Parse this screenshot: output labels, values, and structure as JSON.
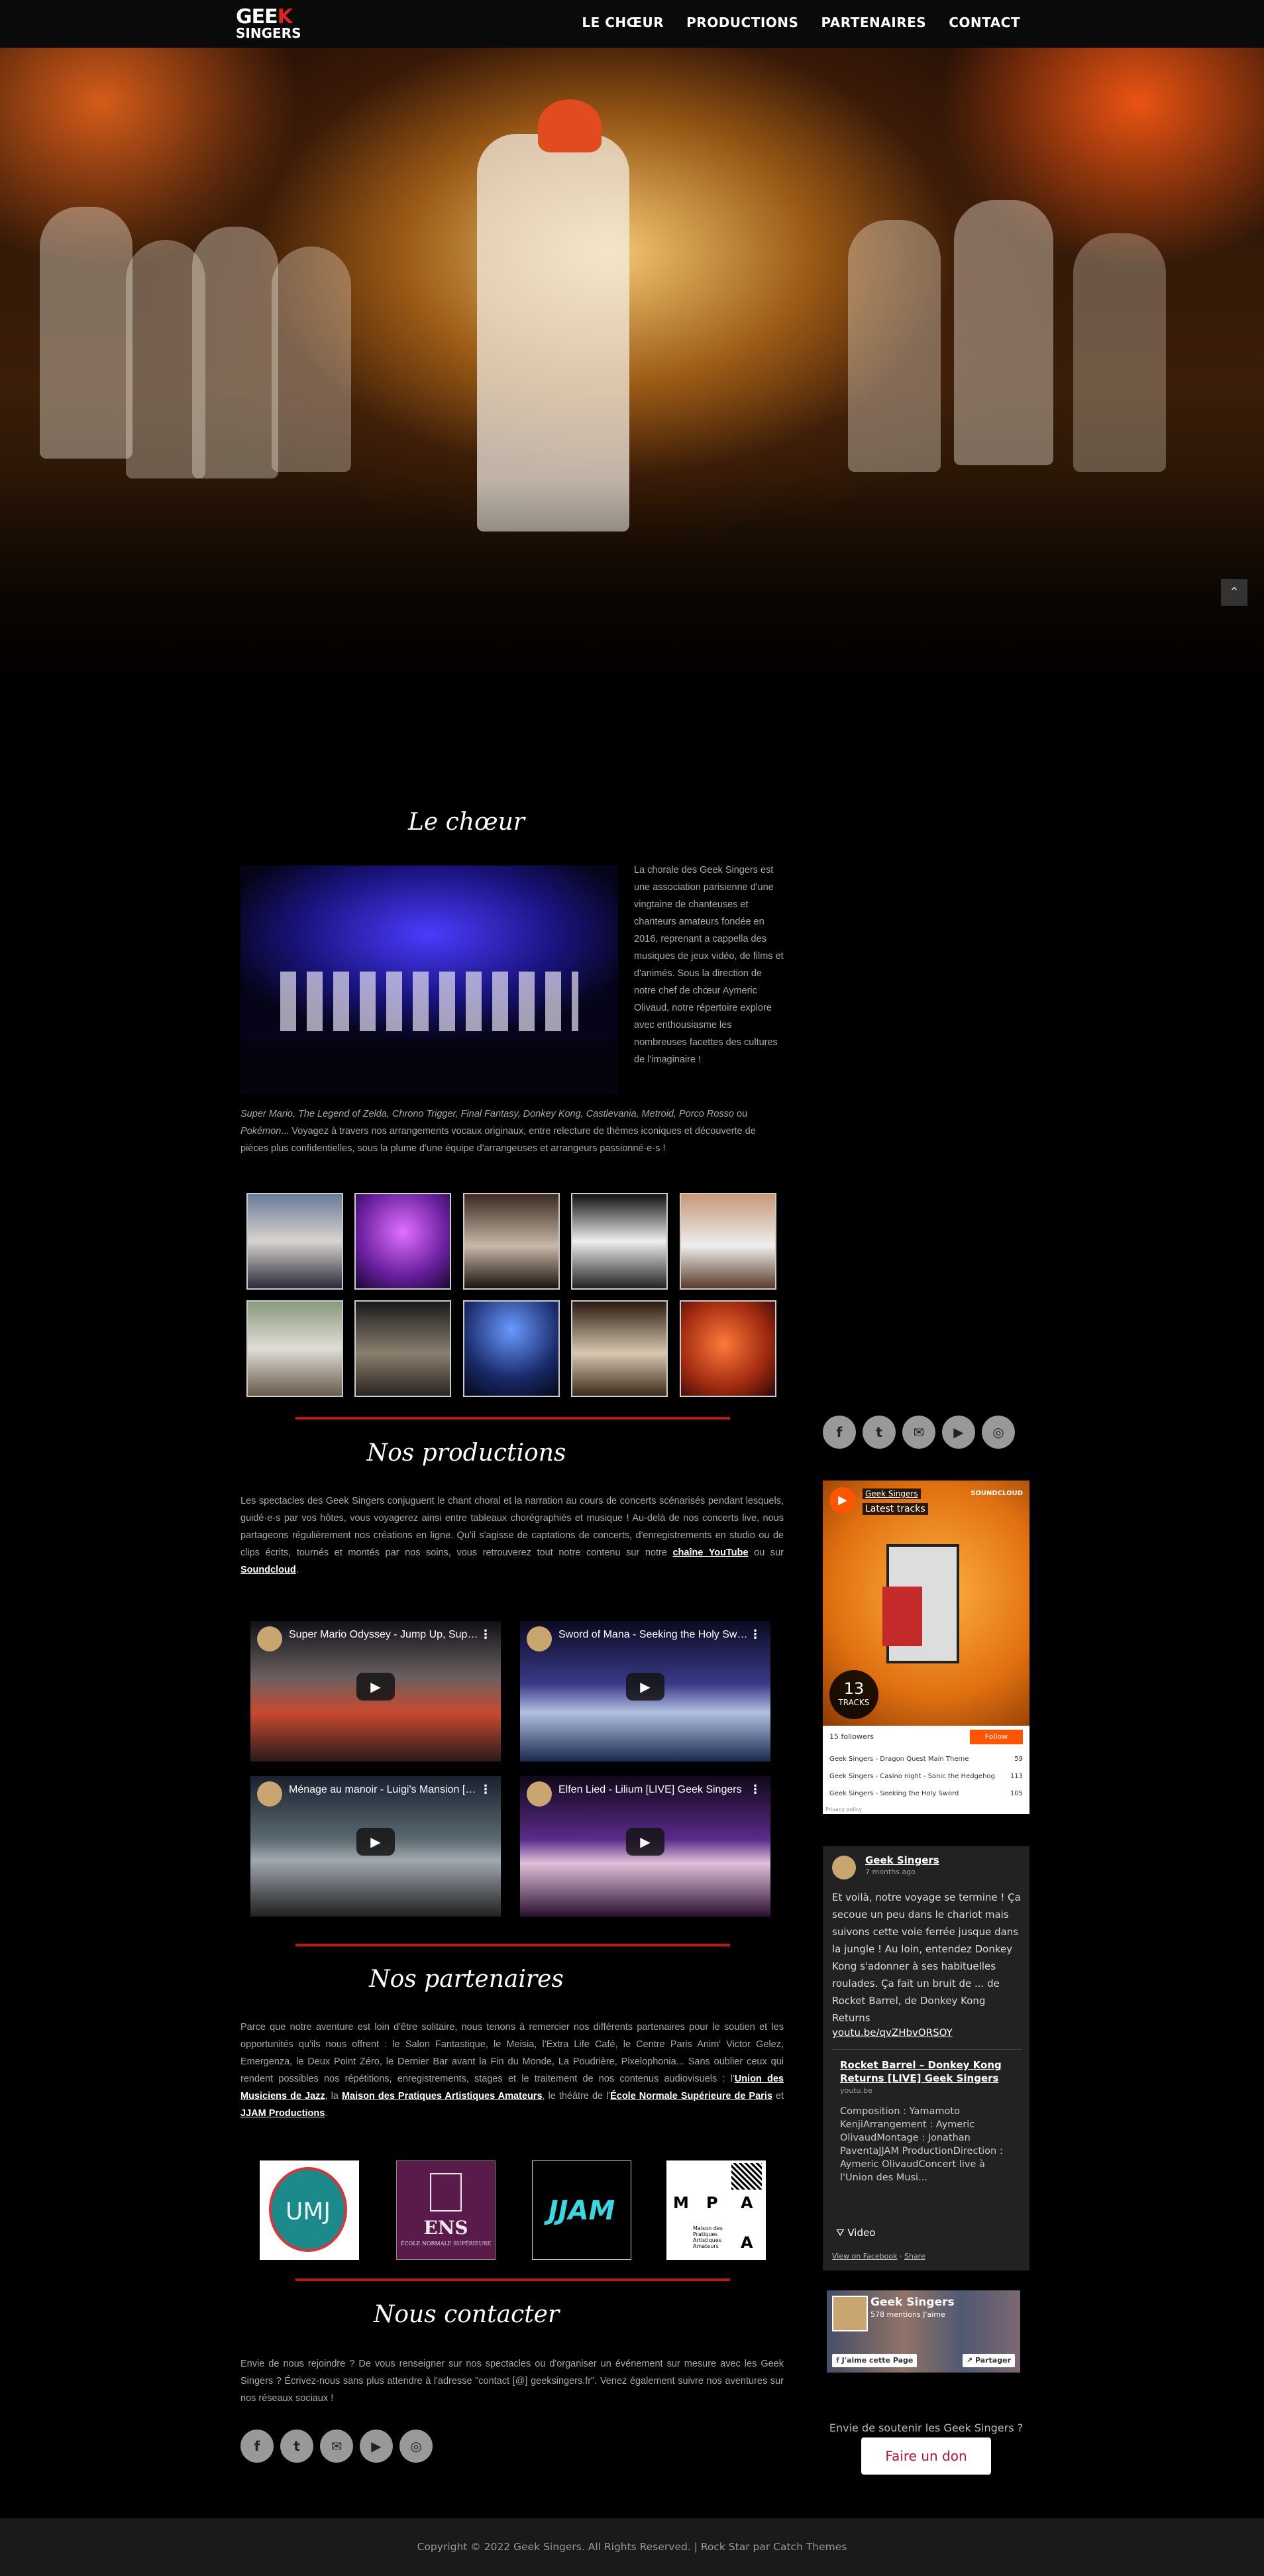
{
  "header": {
    "logo_top": "GEE",
    "logo_k": "K",
    "logo_bottom": "SINGERS",
    "nav": [
      "LE CHŒUR",
      "PRODUCTIONS",
      "PARTENAIRES",
      "CONTACT"
    ]
  },
  "scroll_top_icon": "chevron-up",
  "choeur": {
    "title": "Le chœur",
    "intro": "La chorale des Geek Singers est une association parisienne d'une vingtaine de chanteuses et chanteurs amateurs fondée en 2016, reprenant a cappella des musiques de jeux vidéo, de films et d'animés. Sous la direction de notre chef de chœur Aymeric Olivaud, notre répertoire explore avec enthousiasme les nombreuses facettes des cultures de l'imaginaire !",
    "titles_italic": "Super Mario, The Legend of Zelda, Chrono Trigger, Final Fantasy, Donkey Kong, Castlevania, Metroid, Porco Rosso",
    "ou": " ou ",
    "pokemon": "Pokémon",
    "more": "... Voyagez à travers nos arrangements vocaux originaux, entre relecture de thèmes iconiques et découverte de pièces plus confidentielles, sous la plume d'une équipe d'arrangeuses et arrangeurs passionné·e·s !"
  },
  "productions": {
    "title": "Nos productions",
    "text": "Les spectacles des Geek Singers conjuguent le chant choral et la narration au cours de concerts scénarisés pendant lesquels, guidé·e·s par vos hôtes, vous voyagerez ainsi entre tableaux chorégraphiés et musique ! Au-delà de nos concerts live, nous partageons régulièrement nos créations en ligne. Qu'il s'agisse de captations de concerts, d'enregistrements en studio ou de clips écrits, tournés et montés par nos soins, vous retrouverez tout notre contenu sur notre ",
    "link1": "chaîne YouTube",
    "mid": " ou sur ",
    "link2": "Soundcloud",
    "end": ".",
    "videos": [
      "Super Mario Odyssey - Jump Up, Super Star! [LIVE] Geek Singers",
      "Sword of Mana - Seeking the Holy Sword [LIVE] Geek Singers",
      "Ménage au manoir - Luigi's Mansion [LIVE] Geek Singers",
      "Elfen Lied - Lilium [LIVE] Geek Singers"
    ]
  },
  "partenaires": {
    "title": "Nos partenaires",
    "text": "Parce que notre aventure est loin d'être solitaire, nous tenons à remercier nos différents partenaires pour le soutien et les opportunités qu'ils nous offrent : le Salon Fantastique, le Meisia, l'Extra Life Café, le Centre Paris Anim' Victor Gelez, Emergenza, le Deux Point Zéro, le Dernier Bar avant la Fin du Monde, La Poudrière, Pixelophonia... Sans oublier ceux qui rendent possibles nos répétitions, enregistrements, stages et le traitement de nos contenus audiovisuels : l'",
    "l1": "Union des Musiciens de Jazz",
    "t1": ", la ",
    "l2": "Maison des Pratiques Artistiques Amateurs",
    "t2": ", le théâtre de l'",
    "l3": "École Normale Supérieure de Paris",
    "t3": " et ",
    "l4": "JJAM Productions",
    "t4": ".",
    "logos": {
      "umj": "UMJ",
      "ens": "ENS",
      "ens_sub": "ÉCOLE NORMALE SUPÉRIEURE",
      "jjam": "JJAM",
      "mpaa": [
        "M",
        "P",
        "A",
        "A"
      ],
      "mpaa_sub": "Maison des Pratiques Artistiques Amateurs"
    }
  },
  "contact": {
    "title": "Nous contacter",
    "text": "Envie de nous rejoindre ? De vous renseigner sur nos spectacles ou d'organiser un événement sur mesure avec les Geek Singers ? Écrivez-nous sans plus attendre à l'adresse \"contact [@] geeksingers.fr\". Venez également suivre nos aventures sur nos réseaux sociaux !"
  },
  "social_icons": [
    "facebook",
    "twitter",
    "email",
    "youtube",
    "instagram"
  ],
  "social_glyphs": [
    "f",
    "t",
    "✉",
    "▶",
    "◎"
  ],
  "soundcloud": {
    "user": "Geek Singers",
    "latest": "Latest tracks",
    "brand": "SOUNDCLOUD",
    "count": "13",
    "count_label": "TRACKS",
    "followers": "15 followers",
    "follow": "Follow",
    "tracks": [
      {
        "name": "Geek Singers - Dragon Quest Main Theme",
        "plays": "59"
      },
      {
        "name": "Geek Singers - Casino night - Sonic the Hedgehog",
        "plays": "113"
      },
      {
        "name": "Geek Singers - Seeking the Holy Sword",
        "plays": "105"
      }
    ],
    "privacy": "Privacy policy"
  },
  "fb_post": {
    "author": "Geek Singers",
    "time": "7 months ago",
    "text": "Et voilà, notre voyage se termine ! Ça secoue un peu dans le chariot mais suivons cette voie ferrée jusque dans la jungle ! Au loin, entendez Donkey Kong s'adonner à ses habituelles roulades. Ça fait un bruit de ... de Rocket Barrel, de Donkey Kong Returns",
    "link": "youtu.be/qvZHbvORSOY",
    "card_title": "Rocket Barrel – Donkey Kong Returns [LIVE] Geek Singers",
    "card_domain": "youtu.be",
    "card_desc": "Composition : Yamamoto KenjiArrangement : Aymeric OlivaudMontage : Jonathan PaventaJJAM ProductionDirection : Aymeric OlivaudConcert live à l'Union des Musi...",
    "video_label": "Video",
    "view_fb": "View on Facebook",
    "dot": "·",
    "share": "Share"
  },
  "fb_page": {
    "name": "Geek Singers",
    "likes": "578 mentions J'aime",
    "like_btn": "J'aime cette Page",
    "share_btn": "Partager"
  },
  "donate": {
    "text": "Envie de soutenir les Geek Singers ?",
    "button": "Faire un don"
  },
  "footer": {
    "text": "Copyright © 2022 Geek Singers. All Rights Reserved. | Rock Star par Catch Themes"
  }
}
